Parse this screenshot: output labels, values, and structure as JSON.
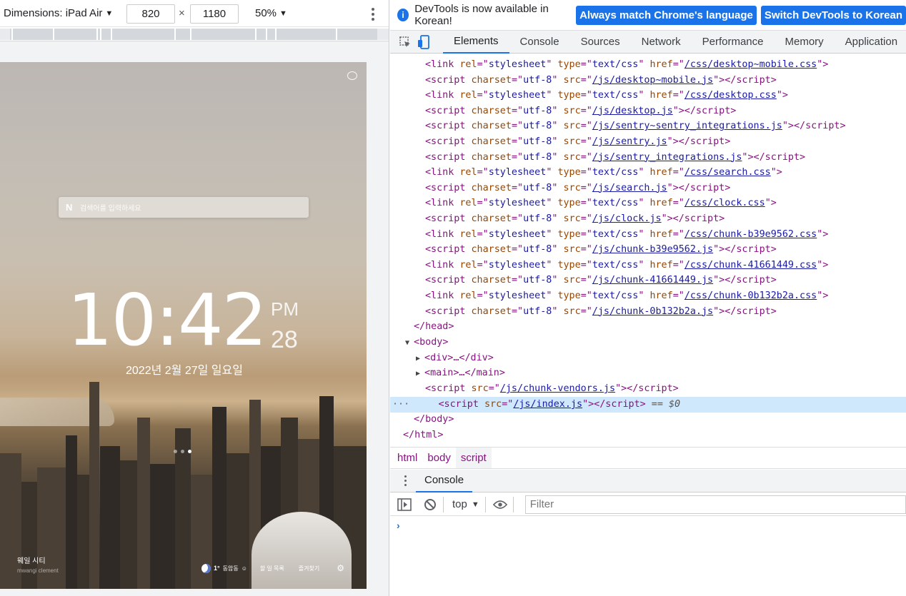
{
  "device_toolbar": {
    "dimensions_label": "Dimensions: iPad Air",
    "width": "820",
    "height": "1180",
    "times": "×",
    "zoom": "50%",
    "caret": "▼"
  },
  "screen": {
    "search_placeholder": "검색어를 입력하세요",
    "naver_logo": "N",
    "time": "10:42",
    "ampm": "PM",
    "seconds": "28",
    "date": "2022년 2월 27일 일요일",
    "city_name": "웨일 시티",
    "city_credit": "mwangi clement",
    "weather_temp": "1°",
    "weather_location": "동암동",
    "weather_symbol": "☺",
    "todo": "할 일 목록",
    "bookmarks": "즐겨찾기",
    "settings_icon": "⚙"
  },
  "infobar": {
    "info_icon": "i",
    "message": "DevTools is now available in Korean!",
    "btn_match": "Always match Chrome's language",
    "btn_switch": "Switch DevTools to Korean"
  },
  "devtools_tabs": [
    "Elements",
    "Console",
    "Sources",
    "Network",
    "Performance",
    "Memory",
    "Application"
  ],
  "elements": {
    "link_rows": [
      {
        "tag": "link",
        "href": "/css/desktop~mobile.css"
      },
      {
        "tag": "script",
        "src": "/js/desktop~mobile.js"
      },
      {
        "tag": "link",
        "href": "/css/desktop.css"
      },
      {
        "tag": "script",
        "src": "/js/desktop.js"
      },
      {
        "tag": "script",
        "src": "/js/sentry~sentry_integrations.js"
      },
      {
        "tag": "script",
        "src": "/js/sentry.js"
      },
      {
        "tag": "script",
        "src": "/js/sentry_integrations.js"
      },
      {
        "tag": "link",
        "href": "/css/search.css"
      },
      {
        "tag": "script",
        "src": "/js/search.js"
      },
      {
        "tag": "link",
        "href": "/css/clock.css"
      },
      {
        "tag": "script",
        "src": "/js/clock.js"
      },
      {
        "tag": "link",
        "href": "/css/chunk-b39e9562.css"
      },
      {
        "tag": "script",
        "src": "/js/chunk-b39e9562.js"
      },
      {
        "tag": "link",
        "href": "/css/chunk-41661449.css"
      },
      {
        "tag": "script",
        "src": "/js/chunk-41661449.js"
      },
      {
        "tag": "link",
        "href": "/css/chunk-0b132b2a.css"
      },
      {
        "tag": "script",
        "src": "/js/chunk-0b132b2a.js"
      }
    ],
    "head_close": "</head>",
    "body_open": "<body>",
    "div_collapsed": "<div>…</div>",
    "main_collapsed": "<main>…</main>",
    "vendors_src": "/js/chunk-vendors.js",
    "index_src": "/js/index.js",
    "dollar0": "== $0",
    "body_close": "</body>",
    "html_close": "</html>",
    "ellipsis": "···"
  },
  "breadcrumbs": [
    "html",
    "body",
    "script"
  ],
  "drawer": {
    "tab": "Console",
    "context": "top",
    "filter_placeholder": "Filter",
    "prompt": "›"
  }
}
